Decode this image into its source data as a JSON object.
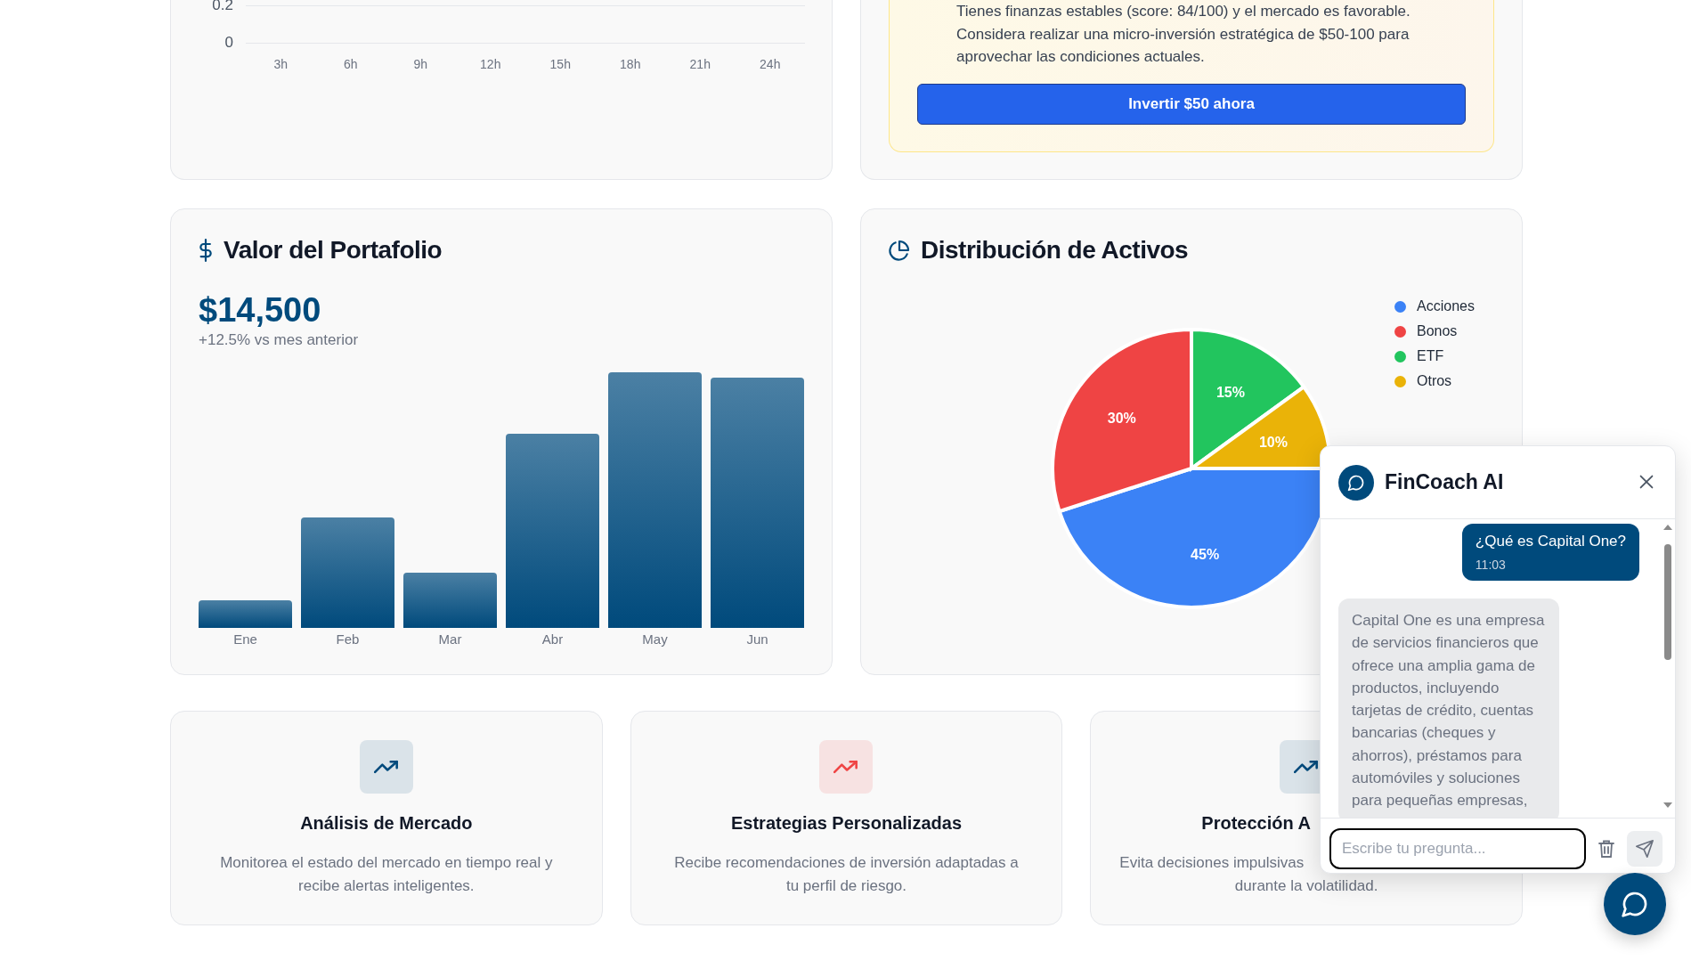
{
  "activity_chart": {
    "y_labels": [
      "0.2",
      "0"
    ],
    "x_labels": [
      "3h",
      "6h",
      "9h",
      "12h",
      "15h",
      "18h",
      "21h",
      "24h"
    ]
  },
  "recommendation": {
    "text": "Tienes finanzas estables (score: 84/100) y el mercado es favorable. Considera realizar una micro-inversión estratégica de $50-100 para aprovechar las condiciones actuales.",
    "button": "Invertir $50 ahora"
  },
  "portfolio": {
    "title": "Valor del Portafolio",
    "value": "$14,500",
    "change": "+12.5% vs mes anterior",
    "months": [
      "Ene",
      "Feb",
      "Mar",
      "Abr",
      "May",
      "Jun"
    ]
  },
  "allocation": {
    "title": "Distribución de Activos",
    "chart_data": {
      "type": "pie",
      "categories": [
        "Acciones",
        "Bonos",
        "ETF",
        "Otros"
      ],
      "values": [
        45,
        30,
        15,
        10
      ],
      "value_labels": [
        "45%",
        "30%",
        "15%",
        "10%"
      ]
    },
    "legend": [
      {
        "color": "#3b82f6"
      },
      {
        "color": "#ef4444"
      },
      {
        "color": "#22c55e"
      },
      {
        "color": "#eab308"
      }
    ]
  },
  "features": [
    {
      "title": "Análisis de Mercado",
      "lines": [
        "Monitorea el estado del mercado en tiempo real y",
        "recibe alertas inteligentes."
      ],
      "color": "#004a7c"
    },
    {
      "title": "Estrategias Personalizadas",
      "lines": [
        "Recibe recomendaciones de inversión adaptadas a",
        "tu perfil de riesgo."
      ],
      "color": "#ef4444"
    },
    {
      "title": "Protección A",
      "lines": [
        "Evita decisiones impulsivas",
        "durante la volatilidad."
      ],
      "color": "#004a7c"
    }
  ],
  "chat": {
    "title": "FinCoach AI",
    "messages": [
      {
        "kind": "user",
        "text": "¿Qué es Capital One?",
        "time": "11:03"
      },
      {
        "kind": "assistant",
        "text": "Capital One es una empresa de servicios financieros que ofrece una amplia gama de productos, incluyendo tarjetas de crédito, cuentas bancarias (cheques y ahorros), préstamos para automóviles y soluciones para pequeñas empresas,"
      }
    ],
    "placeholder": "Escribe tu pregunta..."
  }
}
